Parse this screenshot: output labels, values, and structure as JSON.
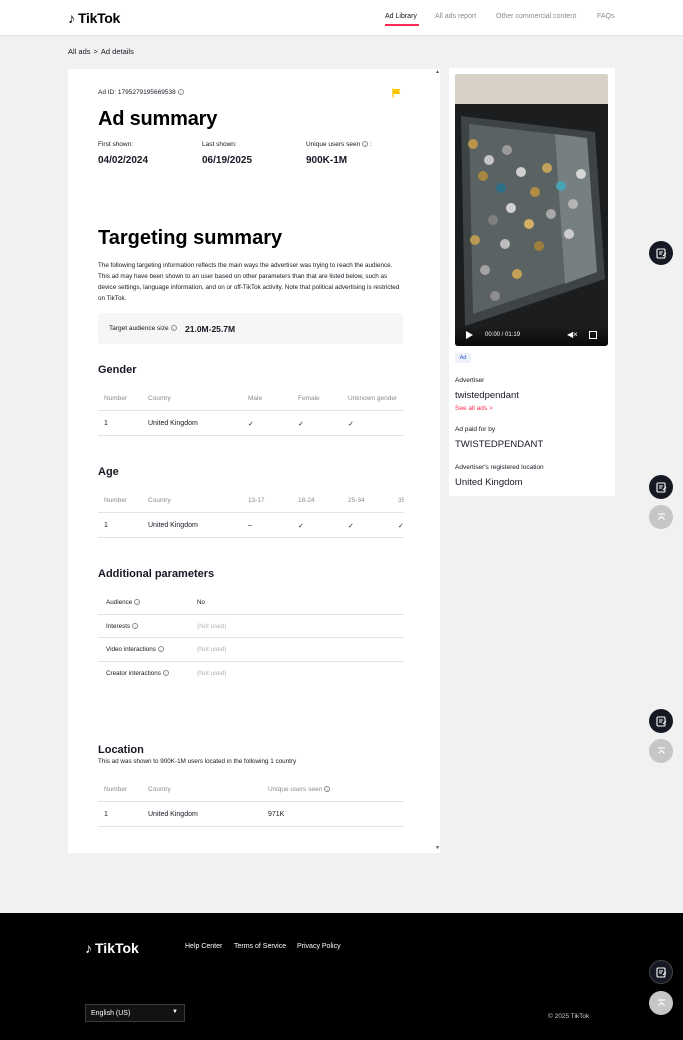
{
  "header": {
    "logo": "TikTok",
    "nav": [
      {
        "label": "Ad Library",
        "active": true
      },
      {
        "label": "All ads report",
        "active": false
      },
      {
        "label": "Other commercial content",
        "active": false
      },
      {
        "label": "FAQs",
        "active": false
      }
    ]
  },
  "breadcrumb": {
    "root": "All ads",
    "separator": ">",
    "current": "Ad details"
  },
  "ad_summary": {
    "ad_id_label": "Ad ID: 1795279195669538",
    "title": "Ad summary",
    "first_shown_label": "First shown:",
    "first_shown": "04/02/2024",
    "last_shown_label": "Last shown:",
    "last_shown": "06/19/2025",
    "unique_users_label": "Unique users seen",
    "unique_users_suffix": ":",
    "unique_users": "900K-1M"
  },
  "targeting": {
    "title": "Targeting summary",
    "description": "The following targeting information reflects the main ways the advertiser was trying to reach the audience. This ad may have been shown to an user based on other parameters than that are listed below, such as device settings, language information, and on or off-TikTok activity. Note that political advertising is restricted on TikTok.",
    "audience_label": "Target audience size",
    "audience_value": "21.0M-25.7M"
  },
  "gender": {
    "title": "Gender",
    "headers": [
      "Number",
      "Country",
      "Male",
      "Female",
      "Unknown gender"
    ],
    "rows": [
      {
        "number": "1",
        "country": "United Kingdom",
        "male": "✓",
        "female": "✓",
        "unknown": "✓"
      }
    ]
  },
  "age": {
    "title": "Age",
    "headers": [
      "Number",
      "Country",
      "13-17",
      "18-24",
      "25-34",
      "35"
    ],
    "rows": [
      {
        "number": "1",
        "country": "United Kingdom",
        "a13": "–",
        "a18": "✓",
        "a25": "✓",
        "a35": "✓"
      }
    ]
  },
  "additional": {
    "title": "Additional parameters",
    "rows": [
      {
        "label": "Audience",
        "value": "No"
      },
      {
        "label": "Interests",
        "value": "(Not used)"
      },
      {
        "label": "Video interactions",
        "value": "(Not used)"
      },
      {
        "label": "Creator interactions",
        "value": "(Not used)"
      }
    ]
  },
  "location": {
    "title": "Location",
    "description": "This ad was shown to 900K-1M users located in the following 1 country",
    "headers": [
      "Number",
      "Country",
      "Unique users seen"
    ],
    "rows": [
      {
        "number": "1",
        "country": "United Kingdom",
        "users": "971K"
      }
    ]
  },
  "side": {
    "video_time": "00:00 / 01:19",
    "ad_badge": "Ad",
    "advertiser_label": "Advertiser",
    "advertiser": "twistedpendant",
    "see_all": "See all ads >",
    "paid_by_label": "Ad paid for by",
    "paid_by": "TWISTEDPENDANT",
    "location_label": "Advertiser's registered location",
    "location": "United Kingdom"
  },
  "footer": {
    "logo": "TikTok",
    "links": [
      "Help Center",
      "Terms of Service",
      "Privacy Policy"
    ],
    "language": "English (US)",
    "copyright": "© 2025 TikTok"
  },
  "colors": {
    "accent": "#fe2c55",
    "flag": "#ffc300",
    "footer": "#000000"
  },
  "icons": [
    "tiktok-note-icon",
    "flag-icon",
    "info-icon",
    "play-icon",
    "mute-icon",
    "fullscreen-icon",
    "feedback-icon",
    "back-to-top-icon"
  ]
}
